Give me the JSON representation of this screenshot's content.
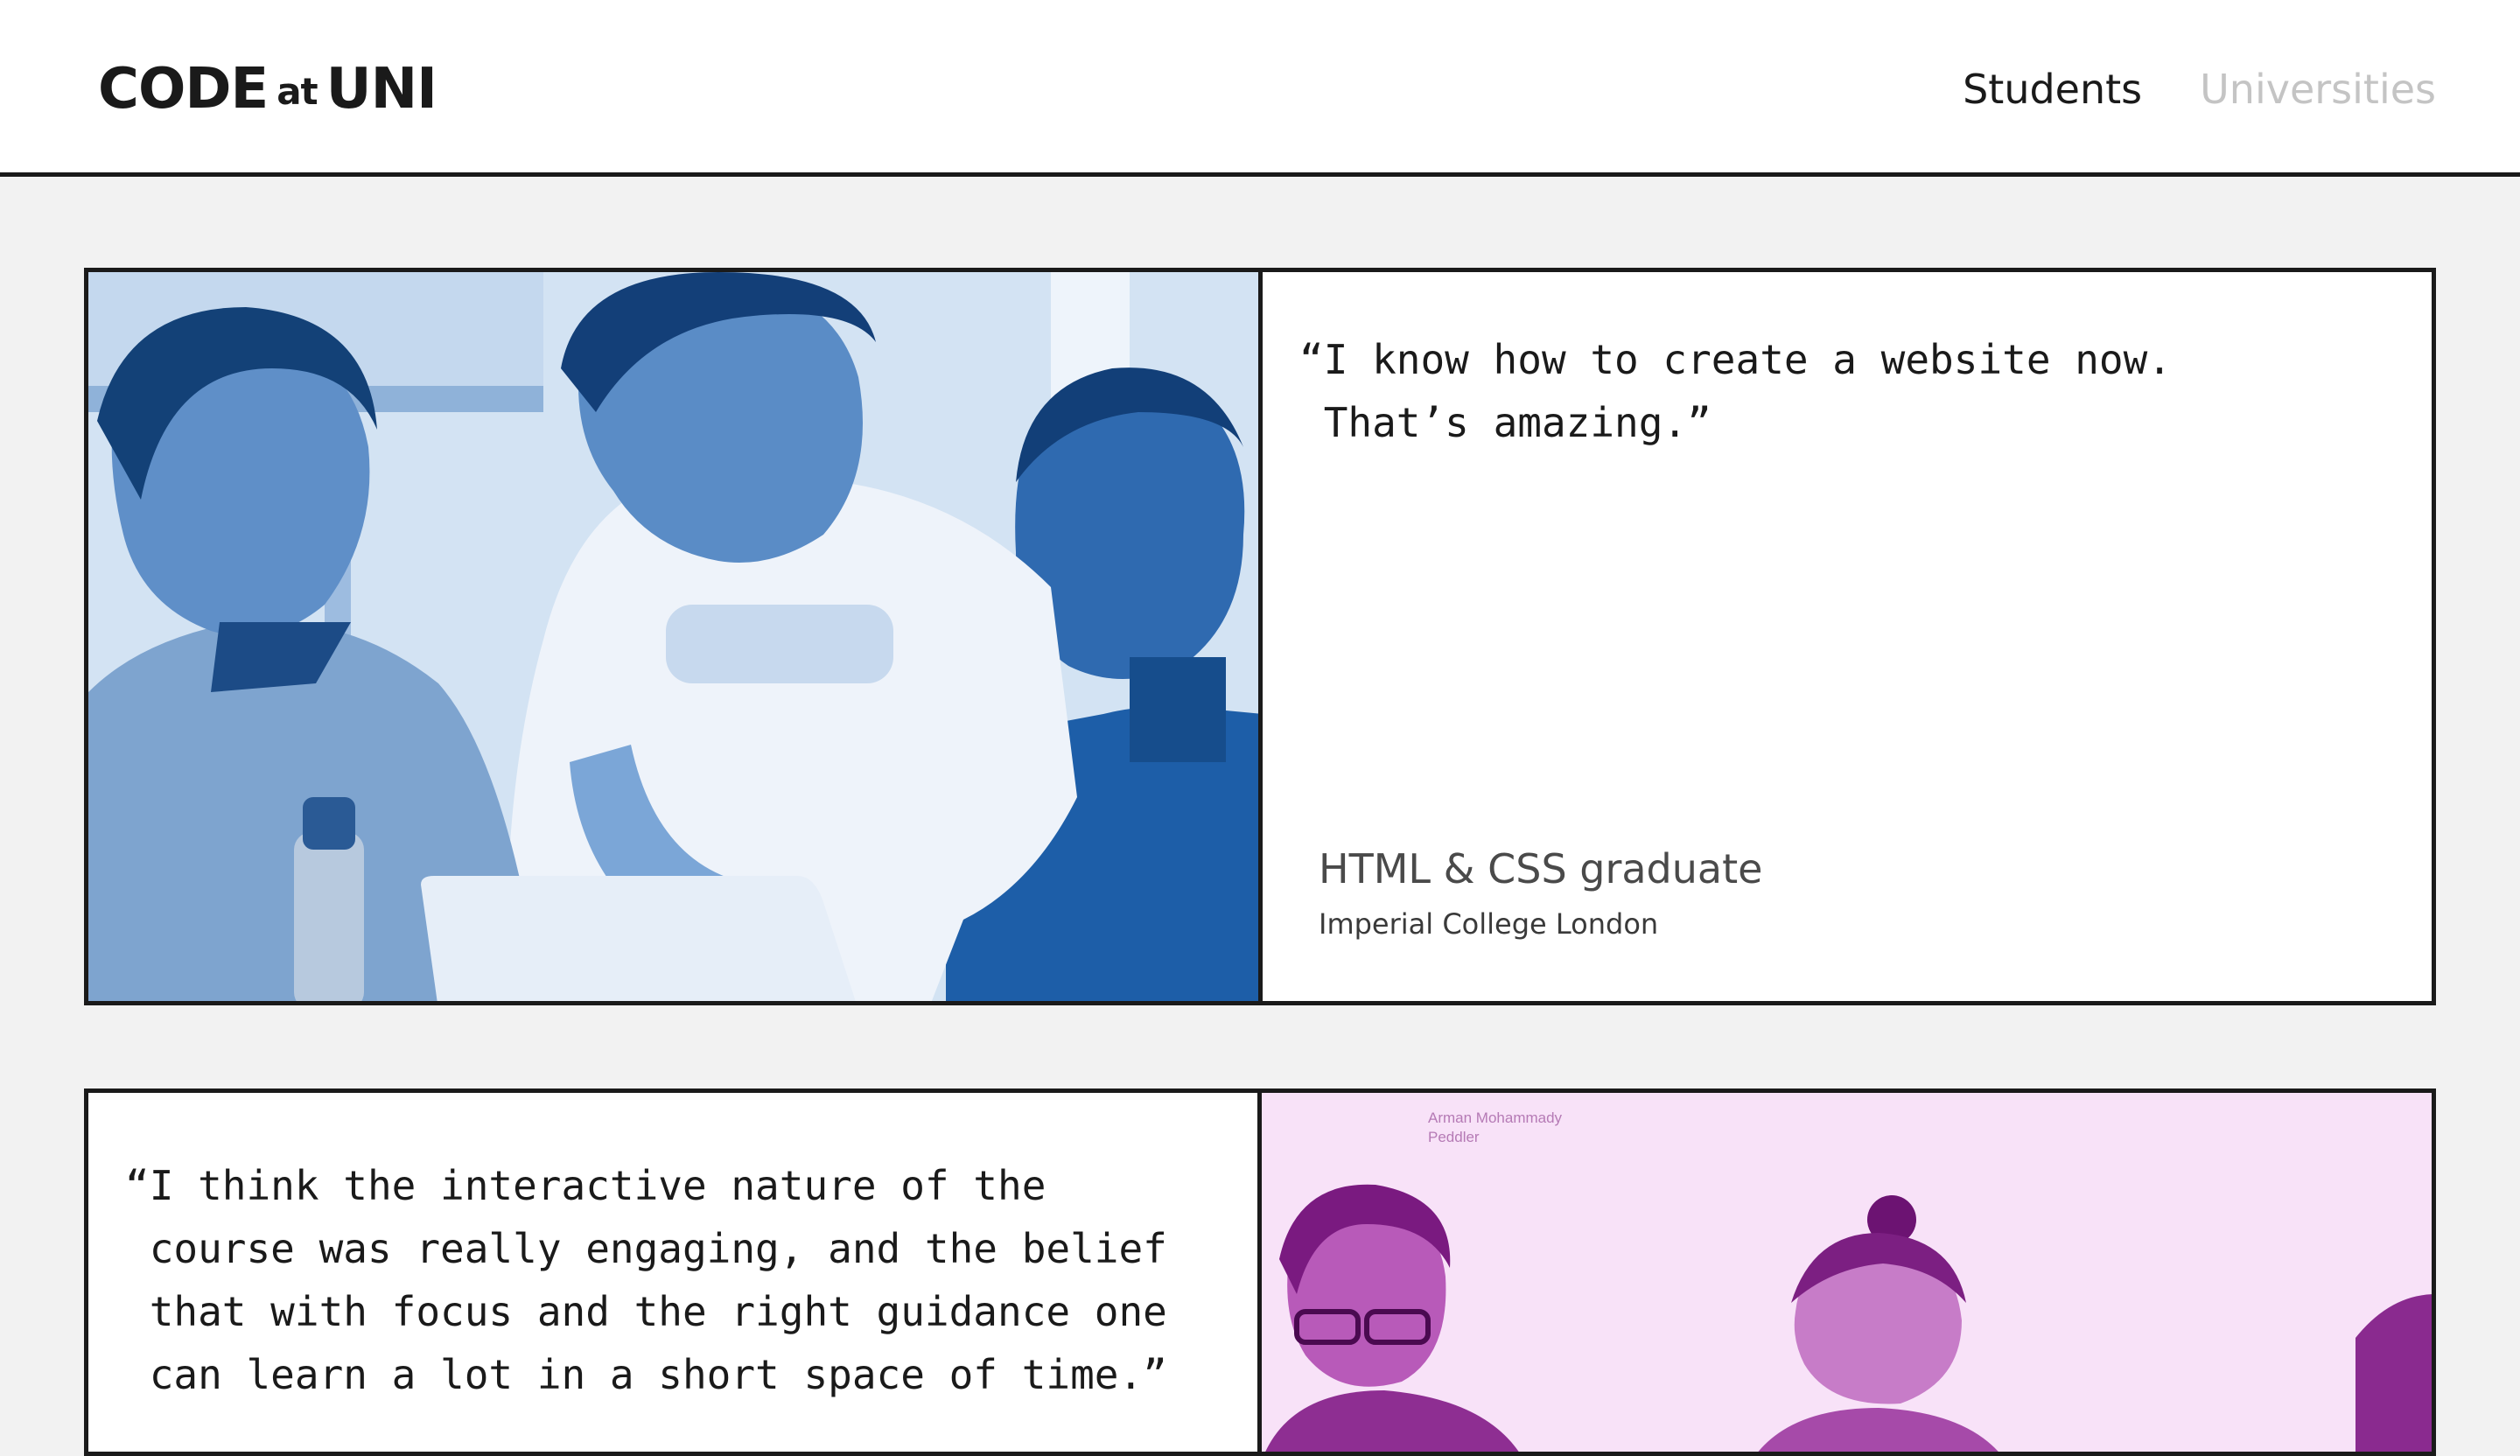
{
  "header": {
    "logo": {
      "left": "CODE",
      "at": "at",
      "right": "UNI"
    },
    "nav": [
      {
        "label": "Students",
        "active": true
      },
      {
        "label": "Universities",
        "active": false
      }
    ]
  },
  "testimonials": [
    {
      "quote": "“I know how to create a website now.\n That’s amazing.”",
      "role": "HTML & CSS graduate",
      "school": "Imperial College London",
      "photo_tint": "#1f63ad"
    },
    {
      "quote": "“I think the interactive nature of the\n course was really engaging, and the belief\n that with focus and the right guidance one\n can learn a lot in a short space of time.”",
      "photo_caption": "Arman Mohammady\nPeddler",
      "photo_tint": "#a32ba6"
    }
  ],
  "colors": {
    "background": "#f2f2f2",
    "border": "#1a1a1a",
    "nav_active": "#1a1a1a",
    "nav_inactive": "#c4c4c4"
  }
}
